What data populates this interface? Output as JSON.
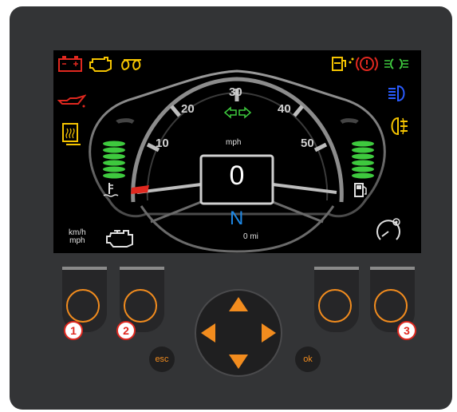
{
  "colors": {
    "accent": "#f28c1e",
    "badge_red": "#e0281f",
    "warning_red": "#e0281f",
    "warning_yellow": "#f5c400",
    "indicator_green": "#3ec93e",
    "indicator_blue": "#2a5cff",
    "gear_blue": "#1e88e5",
    "gauge_green": "#3ec93e",
    "needle_red": "#e0281f"
  },
  "display": {
    "speed_unit": "mph",
    "speed_value": "0",
    "gear": "N",
    "odometer": "0 mi",
    "unit_toggle_top": "km/h",
    "unit_toggle_bottom": "mph",
    "speed_ticks": [
      "10",
      "20",
      "30",
      "40",
      "50"
    ],
    "needle_value": 0,
    "engine_temp_level": 6,
    "fuel_level": 6
  },
  "warning_icons": [
    "battery-warning-icon",
    "check-engine-icon",
    "glow-plug-icon",
    "oil-pressure-icon",
    "defrost-icon",
    "fuel-water-icon",
    "brake-warning-icon",
    "parking-lights-icon",
    "high-beam-icon",
    "rear-fog-light-icon",
    "turn-signal-icon",
    "engine-temp-icon",
    "fuel-pump-icon",
    "engine-icon",
    "cruise-control-icon"
  ],
  "buttons": {
    "badge_1": "1",
    "badge_2": "2",
    "badge_3": "3",
    "esc_label": "esc",
    "ok_label": "ok"
  }
}
